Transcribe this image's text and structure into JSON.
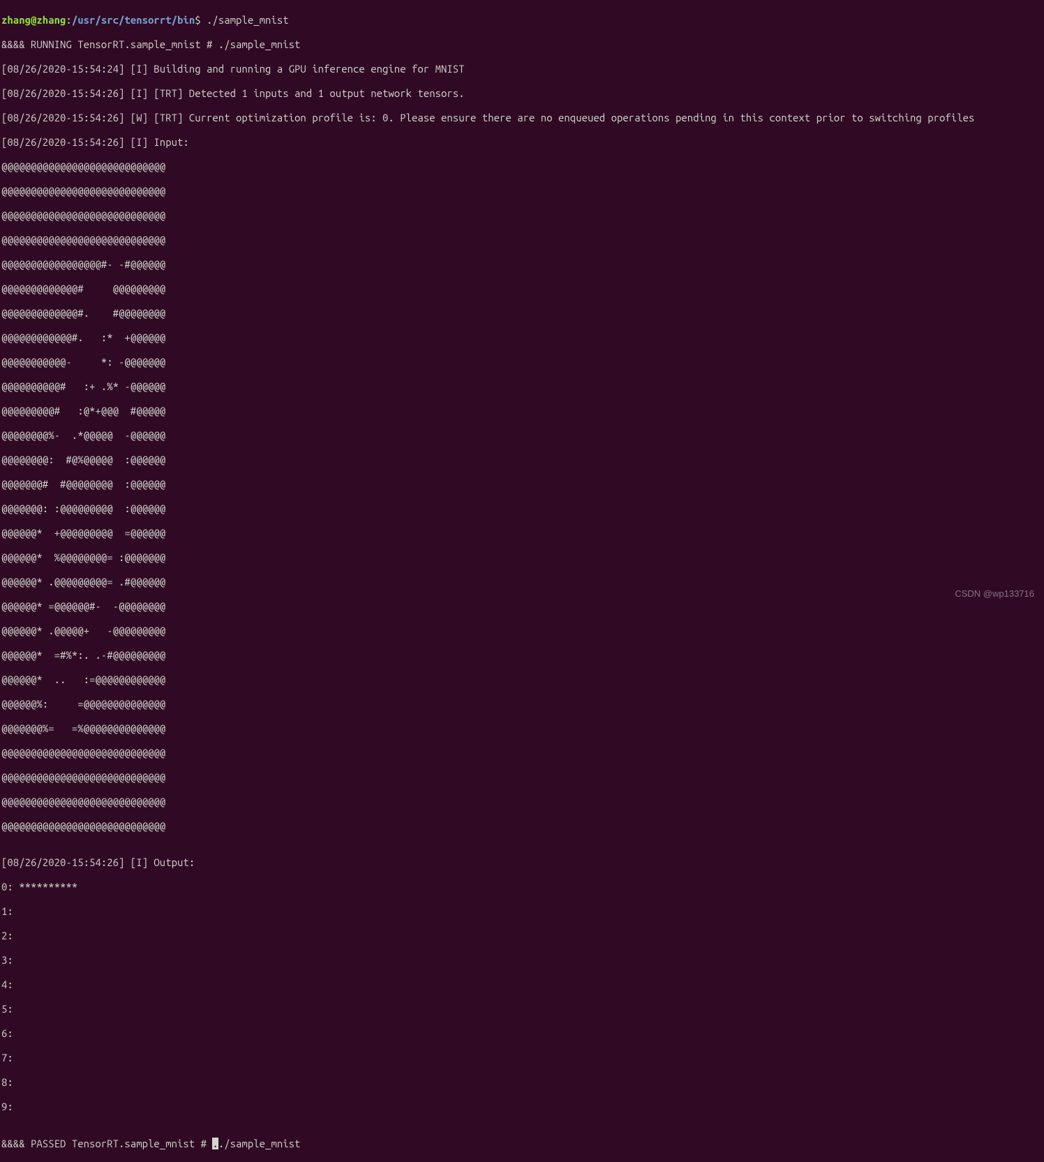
{
  "prompt": {
    "user": "zhang@zhang",
    "separator1": ":",
    "path": "/usr/src/tensorrt/bin",
    "dollar": "$",
    "command": " ./sample_mnist"
  },
  "lines": {
    "l00": "&&&& RUNNING TensorRT.sample_mnist # ./sample_mnist",
    "l01": "[08/26/2020-15:54:24] [I] Building and running a GPU inference engine for MNIST",
    "l02": "[08/26/2020-15:54:26] [I] [TRT] Detected 1 inputs and 1 output network tensors.",
    "l03": "[08/26/2020-15:54:26] [W] [TRT] Current optimization profile is: 0. Please ensure there are no enqueued operations pending in this context prior to switching profiles",
    "l04": "[08/26/2020-15:54:26] [I] Input:",
    "a00": "@@@@@@@@@@@@@@@@@@@@@@@@@@@@",
    "a01": "@@@@@@@@@@@@@@@@@@@@@@@@@@@@",
    "a02": "@@@@@@@@@@@@@@@@@@@@@@@@@@@@",
    "a03": "@@@@@@@@@@@@@@@@@@@@@@@@@@@@",
    "a04": "@@@@@@@@@@@@@@@@@#- -#@@@@@@",
    "a05": "@@@@@@@@@@@@@#     @@@@@@@@@",
    "a06": "@@@@@@@@@@@@@#.    #@@@@@@@@",
    "a07": "@@@@@@@@@@@@#.   :*  +@@@@@@",
    "a08": "@@@@@@@@@@@-     *: -@@@@@@@",
    "a09": "@@@@@@@@@@#   :+ .%* -@@@@@@",
    "a10": "@@@@@@@@@#   :@*+@@@  #@@@@@",
    "a11": "@@@@@@@@%-  .*@@@@@  -@@@@@@",
    "a12": "@@@@@@@@:  #@%@@@@@  :@@@@@@",
    "a13": "@@@@@@@#  #@@@@@@@@  :@@@@@@",
    "a14": "@@@@@@@: :@@@@@@@@@  :@@@@@@",
    "a15": "@@@@@@*  +@@@@@@@@@  =@@@@@@",
    "a16": "@@@@@@*  %@@@@@@@@= :@@@@@@@",
    "a17": "@@@@@@* .@@@@@@@@@= .#@@@@@@",
    "a18": "@@@@@@* =@@@@@@#-  -@@@@@@@@",
    "a19": "@@@@@@* .@@@@@+   -@@@@@@@@@",
    "a20": "@@@@@@*  =#%*:. .-#@@@@@@@@@",
    "a21": "@@@@@@*  ..   :=@@@@@@@@@@@@",
    "a22": "@@@@@@%:     =@@@@@@@@@@@@@@",
    "a23": "@@@@@@@%=   =%@@@@@@@@@@@@@@",
    "a24": "@@@@@@@@@@@@@@@@@@@@@@@@@@@@",
    "a25": "@@@@@@@@@@@@@@@@@@@@@@@@@@@@",
    "a26": "@@@@@@@@@@@@@@@@@@@@@@@@@@@@",
    "a27": "@@@@@@@@@@@@@@@@@@@@@@@@@@@@",
    "blank": "",
    "l05": "[08/26/2020-15:54:26] [I] Output:",
    "o0": "0: **********",
    "o1": "1: ",
    "o2": "2: ",
    "o3": "3: ",
    "o4": "4: ",
    "o5": "5: ",
    "o6": "6: ",
    "o7": "7: ",
    "o8": "8: ",
    "o9": "9: ",
    "last_pre": "&&&& PASSED TensorRT.sample_mnist # ",
    "last_post": "./sample_mnist"
  },
  "watermark": "CSDN @wp133716"
}
